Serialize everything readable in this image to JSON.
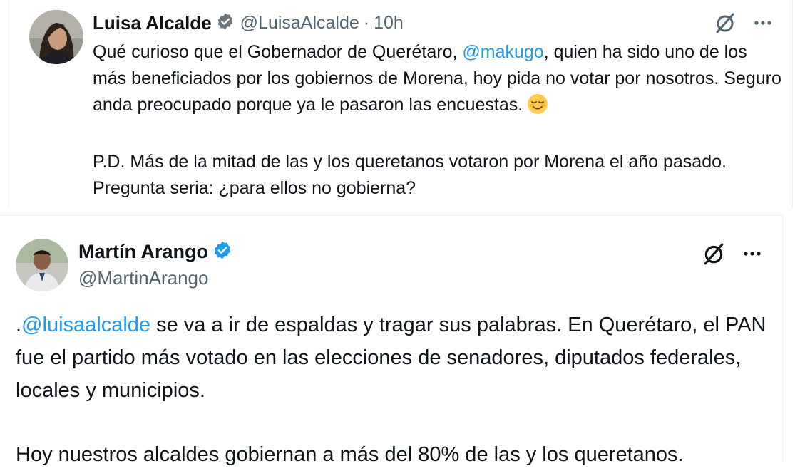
{
  "tweet1": {
    "author_name": "Luisa Alcalde",
    "author_handle": "@LuisaAlcalde",
    "separator": "·",
    "time": "10h",
    "text_p1_before": "Qué curioso que el Gobernador de Querétaro, ",
    "mention": "@makugo",
    "text_p1_after": ", quien ha sido uno de los más beneficiados por los gobiernos de Morena, hoy pida no votar por nosotros. Seguro anda preocupado porque ya le pasaron las encuestas.",
    "emoji": "relieved-face-emoji",
    "text_p2": "P.D. Más de la mitad de las y los queretanos votaron por Morena el año pasado. Pregunta seria: ¿para ellos no gobierna?",
    "verified": true,
    "icons": [
      "grok-icon",
      "more-icon"
    ]
  },
  "tweet2": {
    "author_name": "Martín Arango",
    "author_handle": "@MartinArango",
    "text_p1_prefix": ".",
    "mention": "@luisaalcalde",
    "text_p1_after": " se va a ir de espaldas y tragar sus palabras. En Querétaro, el PAN fue el partido más votado en las elecciones de senadores, diputados federales, locales y municipios.",
    "text_p2": "Hoy nuestros alcaldes gobiernan a más del 80% de las y los queretanos.",
    "verified": true,
    "icons": [
      "grok-icon",
      "more-icon"
    ]
  },
  "colors": {
    "text": "#0f1419",
    "secondary": "#536471",
    "link": "#1d9bf0",
    "verified_badge": "#1d9bf0",
    "divider": "#eff3f4"
  }
}
